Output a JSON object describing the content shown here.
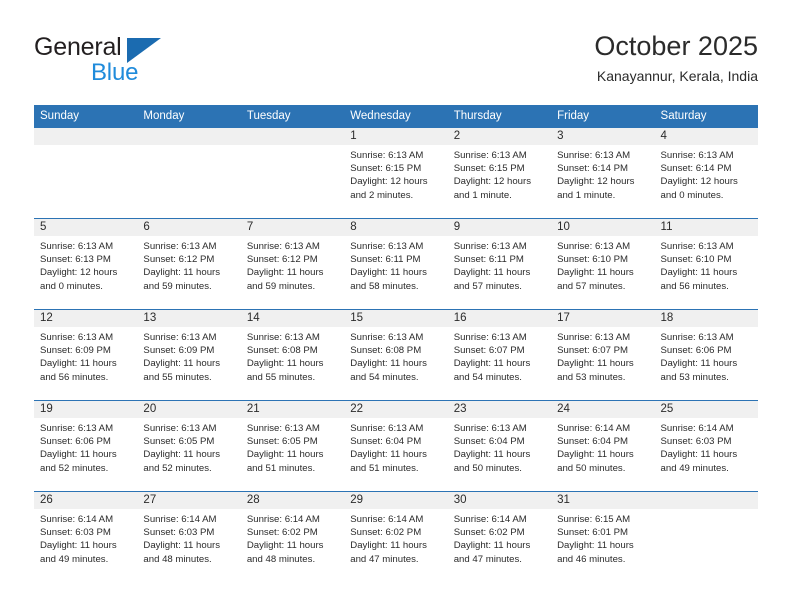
{
  "brand": {
    "line1": "General",
    "line2": "Blue",
    "triangle_icon": "blue-triangle-logo-mark"
  },
  "header": {
    "title": "October 2025",
    "subtitle": "Kanayannur, Kerala, India"
  },
  "colors": {
    "header_blue": "#2c73b4",
    "brand_blue_dark": "#1b6bb0",
    "brand_blue_light": "#1f8bdb",
    "date_band_gray": "#f0f0f0",
    "text": "#2b2b2b"
  },
  "calendar": {
    "weekday_headers": [
      "Sunday",
      "Monday",
      "Tuesday",
      "Wednesday",
      "Thursday",
      "Friday",
      "Saturday"
    ],
    "weeks": [
      [
        {
          "empty": true
        },
        {
          "empty": true
        },
        {
          "empty": true
        },
        {
          "day": "1",
          "sunrise": "Sunrise: 6:13 AM",
          "sunset": "Sunset: 6:15 PM",
          "daylight1": "Daylight: 12 hours",
          "daylight2": "and 2 minutes."
        },
        {
          "day": "2",
          "sunrise": "Sunrise: 6:13 AM",
          "sunset": "Sunset: 6:15 PM",
          "daylight1": "Daylight: 12 hours",
          "daylight2": "and 1 minute."
        },
        {
          "day": "3",
          "sunrise": "Sunrise: 6:13 AM",
          "sunset": "Sunset: 6:14 PM",
          "daylight1": "Daylight: 12 hours",
          "daylight2": "and 1 minute."
        },
        {
          "day": "4",
          "sunrise": "Sunrise: 6:13 AM",
          "sunset": "Sunset: 6:14 PM",
          "daylight1": "Daylight: 12 hours",
          "daylight2": "and 0 minutes."
        }
      ],
      [
        {
          "day": "5",
          "sunrise": "Sunrise: 6:13 AM",
          "sunset": "Sunset: 6:13 PM",
          "daylight1": "Daylight: 12 hours",
          "daylight2": "and 0 minutes."
        },
        {
          "day": "6",
          "sunrise": "Sunrise: 6:13 AM",
          "sunset": "Sunset: 6:12 PM",
          "daylight1": "Daylight: 11 hours",
          "daylight2": "and 59 minutes."
        },
        {
          "day": "7",
          "sunrise": "Sunrise: 6:13 AM",
          "sunset": "Sunset: 6:12 PM",
          "daylight1": "Daylight: 11 hours",
          "daylight2": "and 59 minutes."
        },
        {
          "day": "8",
          "sunrise": "Sunrise: 6:13 AM",
          "sunset": "Sunset: 6:11 PM",
          "daylight1": "Daylight: 11 hours",
          "daylight2": "and 58 minutes."
        },
        {
          "day": "9",
          "sunrise": "Sunrise: 6:13 AM",
          "sunset": "Sunset: 6:11 PM",
          "daylight1": "Daylight: 11 hours",
          "daylight2": "and 57 minutes."
        },
        {
          "day": "10",
          "sunrise": "Sunrise: 6:13 AM",
          "sunset": "Sunset: 6:10 PM",
          "daylight1": "Daylight: 11 hours",
          "daylight2": "and 57 minutes."
        },
        {
          "day": "11",
          "sunrise": "Sunrise: 6:13 AM",
          "sunset": "Sunset: 6:10 PM",
          "daylight1": "Daylight: 11 hours",
          "daylight2": "and 56 minutes."
        }
      ],
      [
        {
          "day": "12",
          "sunrise": "Sunrise: 6:13 AM",
          "sunset": "Sunset: 6:09 PM",
          "daylight1": "Daylight: 11 hours",
          "daylight2": "and 56 minutes."
        },
        {
          "day": "13",
          "sunrise": "Sunrise: 6:13 AM",
          "sunset": "Sunset: 6:09 PM",
          "daylight1": "Daylight: 11 hours",
          "daylight2": "and 55 minutes."
        },
        {
          "day": "14",
          "sunrise": "Sunrise: 6:13 AM",
          "sunset": "Sunset: 6:08 PM",
          "daylight1": "Daylight: 11 hours",
          "daylight2": "and 55 minutes."
        },
        {
          "day": "15",
          "sunrise": "Sunrise: 6:13 AM",
          "sunset": "Sunset: 6:08 PM",
          "daylight1": "Daylight: 11 hours",
          "daylight2": "and 54 minutes."
        },
        {
          "day": "16",
          "sunrise": "Sunrise: 6:13 AM",
          "sunset": "Sunset: 6:07 PM",
          "daylight1": "Daylight: 11 hours",
          "daylight2": "and 54 minutes."
        },
        {
          "day": "17",
          "sunrise": "Sunrise: 6:13 AM",
          "sunset": "Sunset: 6:07 PM",
          "daylight1": "Daylight: 11 hours",
          "daylight2": "and 53 minutes."
        },
        {
          "day": "18",
          "sunrise": "Sunrise: 6:13 AM",
          "sunset": "Sunset: 6:06 PM",
          "daylight1": "Daylight: 11 hours",
          "daylight2": "and 53 minutes."
        }
      ],
      [
        {
          "day": "19",
          "sunrise": "Sunrise: 6:13 AM",
          "sunset": "Sunset: 6:06 PM",
          "daylight1": "Daylight: 11 hours",
          "daylight2": "and 52 minutes."
        },
        {
          "day": "20",
          "sunrise": "Sunrise: 6:13 AM",
          "sunset": "Sunset: 6:05 PM",
          "daylight1": "Daylight: 11 hours",
          "daylight2": "and 52 minutes."
        },
        {
          "day": "21",
          "sunrise": "Sunrise: 6:13 AM",
          "sunset": "Sunset: 6:05 PM",
          "daylight1": "Daylight: 11 hours",
          "daylight2": "and 51 minutes."
        },
        {
          "day": "22",
          "sunrise": "Sunrise: 6:13 AM",
          "sunset": "Sunset: 6:04 PM",
          "daylight1": "Daylight: 11 hours",
          "daylight2": "and 51 minutes."
        },
        {
          "day": "23",
          "sunrise": "Sunrise: 6:13 AM",
          "sunset": "Sunset: 6:04 PM",
          "daylight1": "Daylight: 11 hours",
          "daylight2": "and 50 minutes."
        },
        {
          "day": "24",
          "sunrise": "Sunrise: 6:14 AM",
          "sunset": "Sunset: 6:04 PM",
          "daylight1": "Daylight: 11 hours",
          "daylight2": "and 50 minutes."
        },
        {
          "day": "25",
          "sunrise": "Sunrise: 6:14 AM",
          "sunset": "Sunset: 6:03 PM",
          "daylight1": "Daylight: 11 hours",
          "daylight2": "and 49 minutes."
        }
      ],
      [
        {
          "day": "26",
          "sunrise": "Sunrise: 6:14 AM",
          "sunset": "Sunset: 6:03 PM",
          "daylight1": "Daylight: 11 hours",
          "daylight2": "and 49 minutes."
        },
        {
          "day": "27",
          "sunrise": "Sunrise: 6:14 AM",
          "sunset": "Sunset: 6:03 PM",
          "daylight1": "Daylight: 11 hours",
          "daylight2": "and 48 minutes."
        },
        {
          "day": "28",
          "sunrise": "Sunrise: 6:14 AM",
          "sunset": "Sunset: 6:02 PM",
          "daylight1": "Daylight: 11 hours",
          "daylight2": "and 48 minutes."
        },
        {
          "day": "29",
          "sunrise": "Sunrise: 6:14 AM",
          "sunset": "Sunset: 6:02 PM",
          "daylight1": "Daylight: 11 hours",
          "daylight2": "and 47 minutes."
        },
        {
          "day": "30",
          "sunrise": "Sunrise: 6:14 AM",
          "sunset": "Sunset: 6:02 PM",
          "daylight1": "Daylight: 11 hours",
          "daylight2": "and 47 minutes."
        },
        {
          "day": "31",
          "sunrise": "Sunrise: 6:15 AM",
          "sunset": "Sunset: 6:01 PM",
          "daylight1": "Daylight: 11 hours",
          "daylight2": "and 46 minutes."
        },
        {
          "empty": true
        }
      ]
    ]
  }
}
